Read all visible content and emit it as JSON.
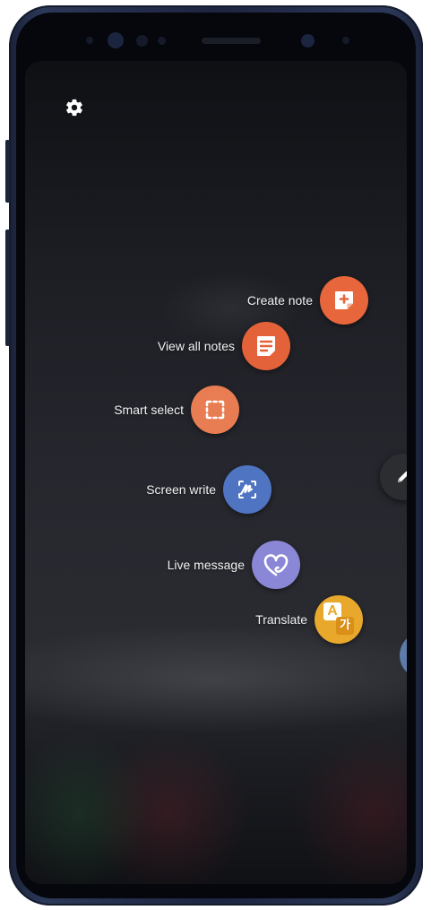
{
  "air_command": {
    "items": [
      {
        "label": "Create note",
        "icon": "create-note-icon",
        "color": "#e8663c"
      },
      {
        "label": "View all notes",
        "icon": "notes-list-icon",
        "color": "#e4623a"
      },
      {
        "label": "Smart select",
        "icon": "smart-select-icon",
        "color": "#e87c52"
      },
      {
        "label": "Screen write",
        "icon": "screen-write-icon",
        "color": "#4f74c2"
      },
      {
        "label": "Live message",
        "icon": "heart-icon",
        "color": "#8a87d6"
      },
      {
        "label": "Translate",
        "icon": "translate-icon",
        "color": "#e8a82c"
      }
    ],
    "translate_glyphs": {
      "latin": "A",
      "korean": "가"
    },
    "pen_button_icon": "pen-icon",
    "partial_button_icon": "shortcut-icon",
    "settings_icon": "gear-icon"
  }
}
